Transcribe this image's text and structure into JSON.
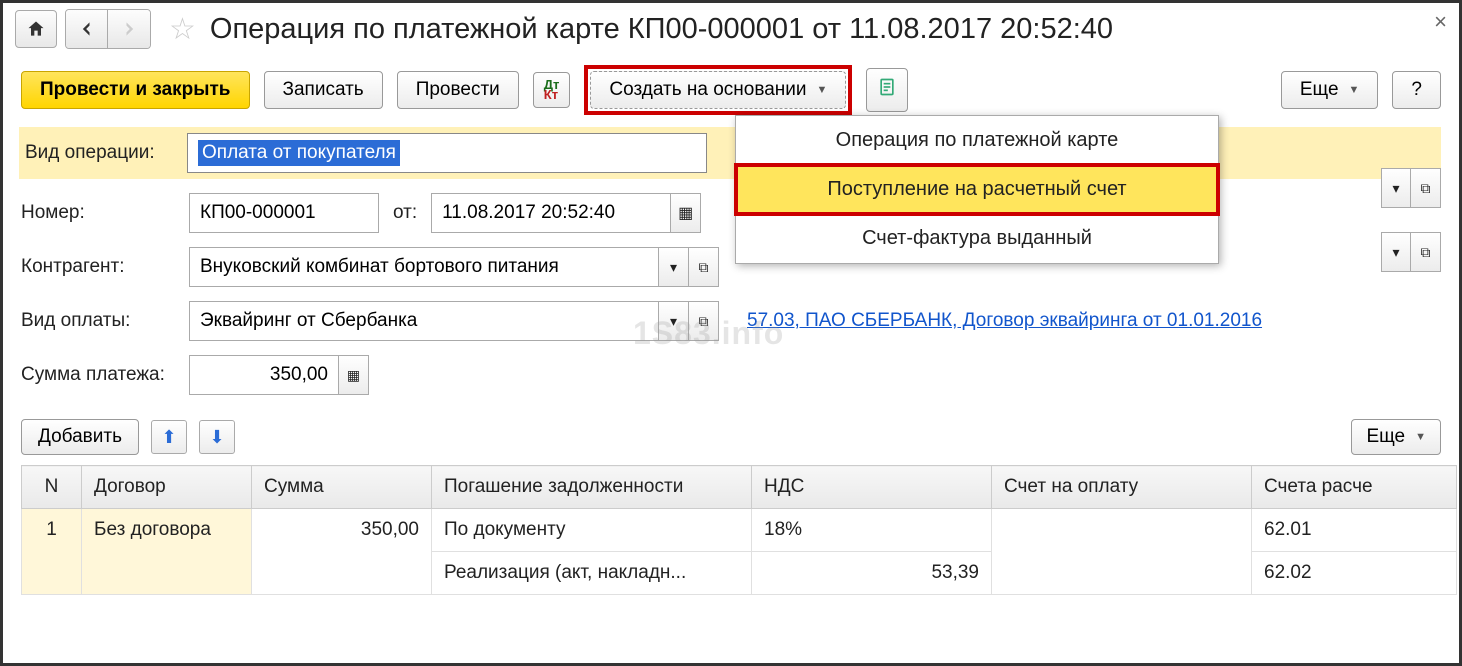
{
  "title": "Операция по платежной карте КП00-000001 от 11.08.2017 20:52:40",
  "toolbar": {
    "post_close": "Провести и закрыть",
    "save": "Записать",
    "post": "Провести",
    "create_basis": "Создать на основании",
    "more": "Еще",
    "help": "?"
  },
  "dropdown": {
    "items": [
      "Операция по платежной карте",
      "Поступление на расчетный счет",
      "Счет-фактура выданный"
    ]
  },
  "form": {
    "op_type_label": "Вид операции:",
    "op_type_value": "Оплата от покупателя",
    "number_label": "Номер:",
    "number_value": "КП00-000001",
    "from_label": "от:",
    "date_value": "11.08.2017 20:52:40",
    "contragent_label": "Контрагент:",
    "contragent_value": "Внуковский комбинат бортового питания",
    "pay_type_label": "Вид оплаты:",
    "pay_type_value": "Эквайринг от Сбербанка",
    "pay_link": "57.03, ПАО СБЕРБАНК, Договор эквайринга от 01.01.2016",
    "sum_label": "Сумма платежа:",
    "sum_value": "350,00"
  },
  "table": {
    "add": "Добавить",
    "more": "Еще",
    "headers": {
      "n": "N",
      "contract": "Договор",
      "sum": "Сумма",
      "repay": "Погашение задолженности",
      "vat": "НДС",
      "invoice": "Счет на оплату",
      "accounts": "Счета расче"
    },
    "row1": {
      "n": "1",
      "contract": "Без договора",
      "sum": "350,00",
      "repay": "По документу",
      "vat": "18%",
      "invoice": "",
      "acct": "62.01"
    },
    "row2": {
      "repay": "Реализация (акт, накладн...",
      "vat": "53,39",
      "acct": "62.02"
    }
  },
  "watermark": "1S83.info"
}
